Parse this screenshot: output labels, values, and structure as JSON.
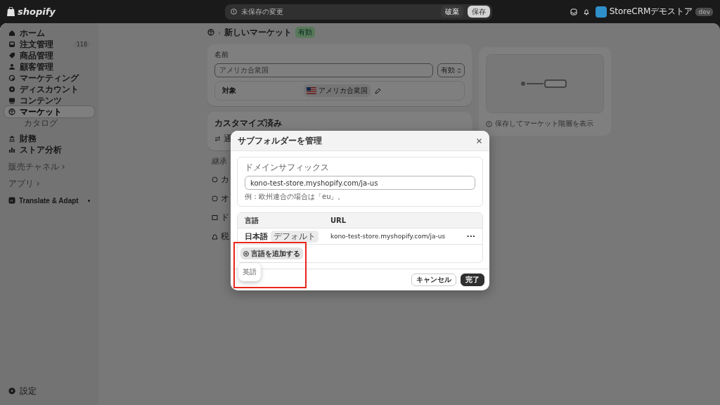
{
  "topbar": {
    "logo": "shopify",
    "unsaved": "未保存の変更",
    "discard": "破棄",
    "save": "保存",
    "store_name": "StoreCRMデモストア",
    "store_badge": "dev"
  },
  "sidebar": {
    "items": [
      {
        "label": "ホーム",
        "selected": false
      },
      {
        "label": "注文管理",
        "selected": false,
        "badge": "118"
      },
      {
        "label": "商品管理",
        "selected": false
      },
      {
        "label": "顧客管理",
        "selected": false
      },
      {
        "label": "マーケティング",
        "selected": false
      },
      {
        "label": "ディスカウント",
        "selected": false
      },
      {
        "label": "コンテンツ",
        "selected": false
      },
      {
        "label": "マーケット",
        "selected": true,
        "children": [
          {
            "label": "カタログ",
            "selected": false
          }
        ]
      },
      {
        "label": "財務",
        "selected": false
      },
      {
        "label": "ストア分析",
        "selected": false
      }
    ],
    "sections": [
      {
        "label": "販売チャネル",
        "chevron": "›"
      },
      {
        "label": "アプリ",
        "chevron": "›"
      }
    ],
    "apps": [
      {
        "label": "Translate & Adapt",
        "pinned": true
      }
    ],
    "settings": "設定"
  },
  "page": {
    "breadcrumb_separator": "›",
    "title": "新しいマーケット",
    "status": "有効",
    "name_card": {
      "label": "名前",
      "value": "アメリカ合衆国",
      "select": "有効",
      "target_label": "対象",
      "target_chip": "アメリカ合衆国"
    },
    "custom_card": {
      "title": "カスタマイズ済み",
      "rows": [
        "通"
      ]
    },
    "inherited": {
      "title": "継承",
      "rows": [
        "カ",
        "オ",
        "ド",
        "税"
      ]
    },
    "side_card": {
      "note": "保存してマーケット階層を表示"
    }
  },
  "modal": {
    "title": "サブフォルダーを管理",
    "domain_label": "ドメインサフィックス",
    "domain_value": "kono-test-store.myshopify.com/ja-us",
    "domain_help": "例：欧州連合の場合は「eu」。",
    "table": {
      "columns": [
        "言語",
        "URL"
      ],
      "rows": [
        {
          "language": "日本語",
          "badge": "デフォルト",
          "url": "kono-test-store.myshopify.com/ja-us",
          "menu": "···"
        }
      ]
    },
    "add_button": "言語を追加する",
    "popover": [
      {
        "label": "英語"
      }
    ],
    "highlight": true,
    "buttons": [
      {
        "label": "キャンセル",
        "kind": "secondary"
      },
      {
        "label": "完了",
        "kind": "primary"
      }
    ]
  }
}
